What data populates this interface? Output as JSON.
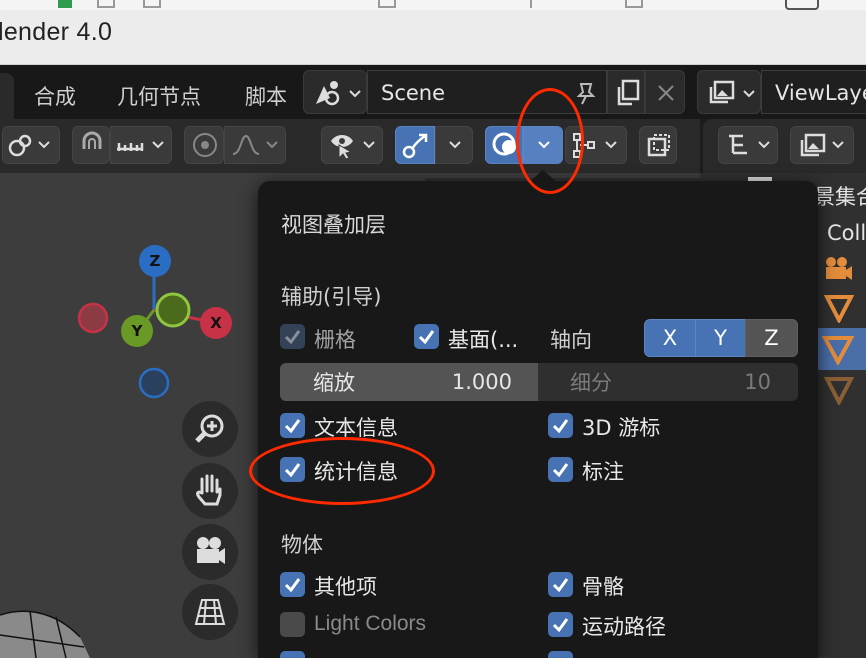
{
  "app": {
    "title": "lender 4.0"
  },
  "tabs": [
    {
      "label": "合成"
    },
    {
      "label": "几何节点"
    },
    {
      "label": "脚本"
    }
  ],
  "scene": {
    "name": "Scene"
  },
  "viewlayer": {
    "name": "ViewLaye"
  },
  "gizmo": {
    "z": "Z",
    "x": "X",
    "y": "Y"
  },
  "outliner": {
    "header": "景集合",
    "collection": "Coll"
  },
  "overlay_popup": {
    "title": "视图叠加层",
    "guides_section": "辅助(引导)",
    "grid": {
      "label": "栅格",
      "checked": true
    },
    "floor": {
      "label": "基面(...",
      "checked": true
    },
    "axes_label": "轴向",
    "axes": [
      "X",
      "Y",
      "Z"
    ],
    "scale": {
      "label": "缩放",
      "value": "1.000"
    },
    "subdivisions": {
      "label": "细分",
      "value": "10"
    },
    "text_info": {
      "label": "文本信息",
      "checked": true
    },
    "cursor_3d": {
      "label": "3D 游标",
      "checked": true
    },
    "statistics": {
      "label": "统计信息",
      "checked": true
    },
    "annotations": {
      "label": "标注",
      "checked": true
    },
    "objects_section": "物体",
    "extras": {
      "label": "其他项",
      "checked": true
    },
    "bones": {
      "label": "骨骼",
      "checked": true
    },
    "light_colors": {
      "label": "Light Colors",
      "checked": false
    },
    "motion_paths": {
      "label": "运动路径",
      "checked": true
    }
  },
  "colors": {
    "accent": "#4772b3",
    "annotation": "#ff2a00",
    "axis_x": "#c83246",
    "axis_y": "#6a9a26",
    "axis_z": "#2a6ec4"
  }
}
